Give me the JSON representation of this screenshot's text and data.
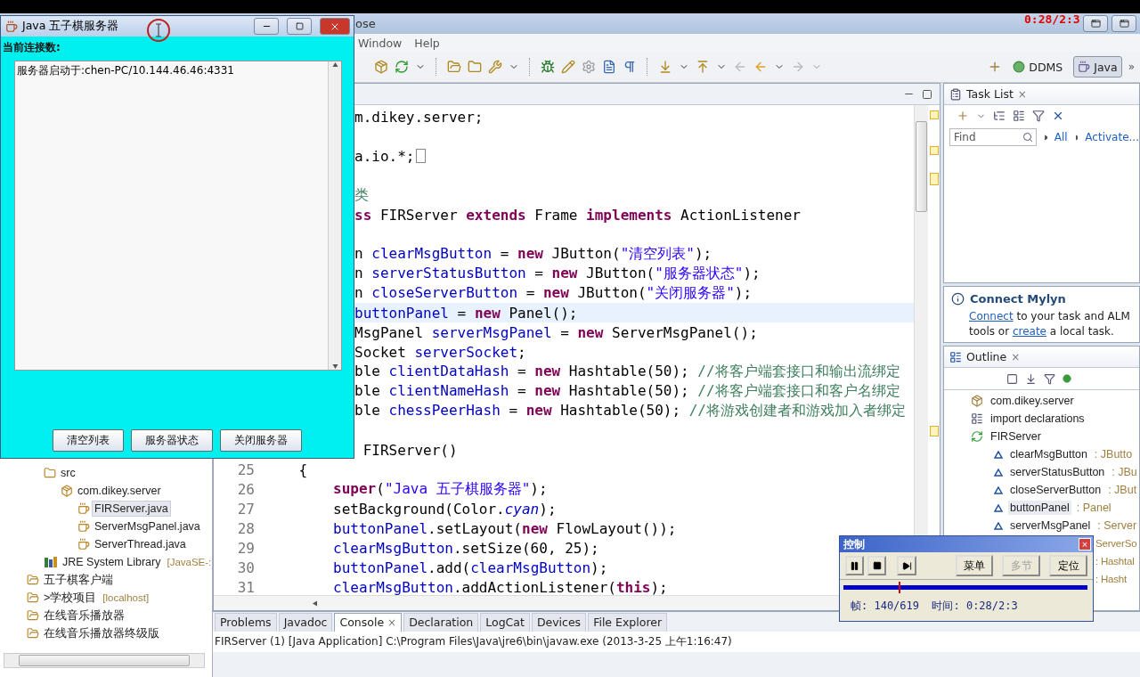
{
  "ide_window": {
    "title": "ose",
    "overlay_time": "0:28/2:3"
  },
  "menu": [
    "Window",
    "Help"
  ],
  "perspectives": [
    {
      "label": "DDMS",
      "selected": false
    },
    {
      "label": "Java",
      "selected": true
    }
  ],
  "perspective_more": "»",
  "explorer": {
    "open_project_contents": [
      {
        "label": "src",
        "kind": "source",
        "children": [
          {
            "label": "com.dikey.server",
            "kind": "package",
            "children": [
              {
                "label": "FIRServer.java",
                "kind": "file",
                "selected": true
              },
              {
                "label": "ServerMsgPanel.java",
                "kind": "file",
                "selected": false
              },
              {
                "label": "ServerThread.java",
                "kind": "file",
                "selected": false
              }
            ]
          }
        ]
      },
      {
        "label": "JRE System Library",
        "suffix": "[JavaSE-:",
        "kind": "library"
      }
    ],
    "projects": [
      {
        "label": "五子棋客户端"
      },
      {
        "label": ">学校项目",
        "suffix": "[localhost]"
      },
      {
        "label": "在线音乐播放器"
      },
      {
        "label": "在线音乐播放器终级版"
      }
    ]
  },
  "editor": {
    "lines": [
      {
        "current": false,
        "segments": [
          {
            "kind": "plain",
            "text": "m.dikey.server;"
          }
        ]
      },
      {
        "current": false
      },
      {
        "current": false,
        "folded": true,
        "segments": [
          {
            "kind": "plain",
            "text": "a.io.*;"
          }
        ]
      },
      {
        "current": false
      },
      {
        "current": false,
        "segments": [
          {
            "kind": "comment",
            "text": "类"
          }
        ]
      },
      {
        "current": false,
        "segments": [
          {
            "kind": "kw",
            "text": "ss "
          },
          {
            "kind": "plain",
            "text": "FIRServer "
          },
          {
            "kind": "kw",
            "text": "extends "
          },
          {
            "kind": "plain",
            "text": "Frame "
          },
          {
            "kind": "kw",
            "text": "implements "
          },
          {
            "kind": "plain",
            "text": "ActionListener"
          }
        ]
      },
      {
        "current": false
      },
      {
        "current": false,
        "segments": [
          {
            "kind": "plain",
            "text": "n "
          },
          {
            "kind": "field",
            "text": "clearMsgButton"
          },
          {
            "kind": "plain",
            "text": " = "
          },
          {
            "kind": "kw",
            "text": "new "
          },
          {
            "kind": "plain",
            "text": "JButton("
          },
          {
            "kind": "str",
            "text": "\"清空列表\""
          },
          {
            "kind": "plain",
            "text": ");"
          }
        ]
      },
      {
        "current": false,
        "segments": [
          {
            "kind": "plain",
            "text": "n "
          },
          {
            "kind": "field",
            "text": "serverStatusButton"
          },
          {
            "kind": "plain",
            "text": " = "
          },
          {
            "kind": "kw",
            "text": "new "
          },
          {
            "kind": "plain",
            "text": "JButton("
          },
          {
            "kind": "str",
            "text": "\"服务器状态\""
          },
          {
            "kind": "plain",
            "text": ");"
          }
        ]
      },
      {
        "current": false,
        "segments": [
          {
            "kind": "plain",
            "text": "n "
          },
          {
            "kind": "field",
            "text": "closeServerButton"
          },
          {
            "kind": "plain",
            "text": " = "
          },
          {
            "kind": "kw",
            "text": "new "
          },
          {
            "kind": "plain",
            "text": "JButton("
          },
          {
            "kind": "str",
            "text": "\"关闭服务器\""
          },
          {
            "kind": "plain",
            "text": ");"
          }
        ]
      },
      {
        "current": true,
        "segments": [
          {
            "kind": "field",
            "text": "buttonPanel"
          },
          {
            "kind": "plain",
            "text": " = "
          },
          {
            "kind": "kw",
            "text": "new "
          },
          {
            "kind": "plain",
            "text": "Panel();"
          }
        ]
      },
      {
        "current": false,
        "segments": [
          {
            "kind": "plain",
            "text": "MsgPanel "
          },
          {
            "kind": "field",
            "text": "serverMsgPanel"
          },
          {
            "kind": "plain",
            "text": " = "
          },
          {
            "kind": "kw",
            "text": "new "
          },
          {
            "kind": "plain",
            "text": "ServerMsgPanel();"
          }
        ]
      },
      {
        "current": false,
        "segments": [
          {
            "kind": "plain",
            "text": "Socket "
          },
          {
            "kind": "field",
            "text": "serverSocket"
          },
          {
            "kind": "plain",
            "text": ";"
          }
        ]
      },
      {
        "current": false,
        "segments": [
          {
            "kind": "plain",
            "text": "ble "
          },
          {
            "kind": "field",
            "text": "clientDataHash"
          },
          {
            "kind": "plain",
            "text": " = "
          },
          {
            "kind": "kw",
            "text": "new "
          },
          {
            "kind": "plain",
            "text": "Hashtable(50); "
          },
          {
            "kind": "comment",
            "text": "//将客户端套接口和输出流绑定"
          }
        ]
      },
      {
        "current": false,
        "segments": [
          {
            "kind": "plain",
            "text": "ble "
          },
          {
            "kind": "field",
            "text": "clientNameHash"
          },
          {
            "kind": "plain",
            "text": " = "
          },
          {
            "kind": "kw",
            "text": "new "
          },
          {
            "kind": "plain",
            "text": "Hashtable(50); "
          },
          {
            "kind": "comment",
            "text": "//将客户端套接口和客户名绑定"
          }
        ]
      },
      {
        "current": false,
        "segments": [
          {
            "kind": "plain",
            "text": "ble "
          },
          {
            "kind": "field",
            "text": "chessPeerHash"
          },
          {
            "kind": "plain",
            "text": " = "
          },
          {
            "kind": "kw",
            "text": "new "
          },
          {
            "kind": "plain",
            "text": "Hashtable(50); "
          },
          {
            "kind": "comment",
            "text": "//将游戏创建者和游戏加入者绑定"
          }
        ]
      },
      {
        "current": false
      },
      {
        "current": false,
        "segments": [
          {
            "kind": "plain",
            "text": " FIRServer()"
          }
        ]
      },
      {
        "current": false,
        "num": "25",
        "segments": [
          {
            "kind": "plain",
            "text": "    {"
          }
        ]
      },
      {
        "current": false,
        "num": "26",
        "segments": [
          {
            "kind": "kw",
            "text": "        super"
          },
          {
            "kind": "plain",
            "text": "("
          },
          {
            "kind": "str",
            "text": "\"Java 五子棋服务器\""
          },
          {
            "kind": "plain",
            "text": ");"
          }
        ]
      },
      {
        "current": false,
        "num": "27",
        "segments": [
          {
            "kind": "plain",
            "text": "        setBackground(Color."
          },
          {
            "kind": "static",
            "text": "cyan"
          },
          {
            "kind": "plain",
            "text": ");"
          }
        ]
      },
      {
        "current": false,
        "num": "28",
        "segments": [
          {
            "kind": "field",
            "text": "        buttonPanel"
          },
          {
            "kind": "plain",
            "text": ".setLayout("
          },
          {
            "kind": "kw",
            "text": "new "
          },
          {
            "kind": "plain",
            "text": "FlowLayout());"
          }
        ]
      },
      {
        "current": false,
        "num": "29",
        "segments": [
          {
            "kind": "field",
            "text": "        clearMsgButton"
          },
          {
            "kind": "plain",
            "text": ".setSize(60, 25);"
          }
        ]
      },
      {
        "current": false,
        "num": "30",
        "segments": [
          {
            "kind": "field",
            "text": "        buttonPanel"
          },
          {
            "kind": "plain",
            "text": ".add("
          },
          {
            "kind": "field",
            "text": "clearMsgButton"
          },
          {
            "kind": "plain",
            "text": ");"
          }
        ]
      },
      {
        "current": false,
        "num": "31",
        "segments": [
          {
            "kind": "field",
            "text": "        clearMsgButton"
          },
          {
            "kind": "plain",
            "text": ".addActionListener("
          },
          {
            "kind": "kw",
            "text": "this"
          },
          {
            "kind": "plain",
            "text": ");"
          }
        ]
      }
    ]
  },
  "task_list": {
    "tab": "Task List",
    "close": "×",
    "find": {
      "placeholder": "Find"
    },
    "links": [
      "All",
      "Activate..."
    ]
  },
  "mylyn": {
    "title": "Connect Mylyn",
    "text": [
      {
        "kind": "link",
        "text": "Connect"
      },
      {
        "kind": "plain",
        "text": " to your task and ALM tools or "
      },
      {
        "kind": "link",
        "text": "create"
      },
      {
        "kind": "plain",
        "text": " a local task."
      }
    ]
  },
  "outline": {
    "tab": "Outline",
    "close": "×",
    "items": [
      {
        "kind": "package",
        "name": "com.dikey.server"
      },
      {
        "kind": "import",
        "name": "import declarations"
      },
      {
        "kind": "class",
        "name": "FIRServer",
        "children": [
          {
            "kind": "field",
            "name": "clearMsgButton",
            "type": ": JButto",
            "selected": false
          },
          {
            "kind": "field",
            "name": "serverStatusButton",
            "type": ": JBu",
            "selected": false
          },
          {
            "kind": "field",
            "name": "closeServerButton",
            "type": ": JBut",
            "selected": false
          },
          {
            "kind": "field",
            "name": "buttonPanel",
            "type": ": Panel",
            "selected": true
          },
          {
            "kind": "field",
            "name": "serverMsgPanel",
            "type": ": Server",
            "selected": false
          },
          {
            "kind": "covered",
            "type": "ServerSo"
          },
          {
            "kind": "covered",
            "type": ": Hashtal"
          },
          {
            "kind": "covered",
            "type": ": Hasht"
          }
        ]
      }
    ]
  },
  "console": {
    "tabs": [
      {
        "label": "Problems",
        "selected": false
      },
      {
        "label": "Javadoc",
        "selected": false
      },
      {
        "label": "Console",
        "selected": true,
        "close": "×"
      },
      {
        "label": "Declaration",
        "selected": false
      },
      {
        "label": "LogCat",
        "selected": false
      },
      {
        "label": "Devices",
        "selected": false
      },
      {
        "label": "File Explorer",
        "selected": false
      }
    ],
    "text": "FIRServer (1) [Java Application] C:\\Program Files\\Java\\jre6\\bin\\javaw.exe (2013-3-25 上午1:16:47)"
  },
  "server_window": {
    "title": "Java 五子棋服务器",
    "label": "当前连接数:",
    "log": "服务器启动于:chen-PC/10.144.46.46:4331",
    "buttons": [
      "清空列表",
      "服务器状态",
      "关闭服务器"
    ]
  },
  "player": {
    "title": "控制",
    "close": "×",
    "buttons": [
      {
        "label": "菜单",
        "disabled": false
      },
      {
        "label": "多节",
        "disabled": true
      },
      {
        "label": "定位",
        "disabled": false
      }
    ],
    "level": 0.226,
    "status": "帧: 140/619  时间: 0:28/2:3"
  }
}
